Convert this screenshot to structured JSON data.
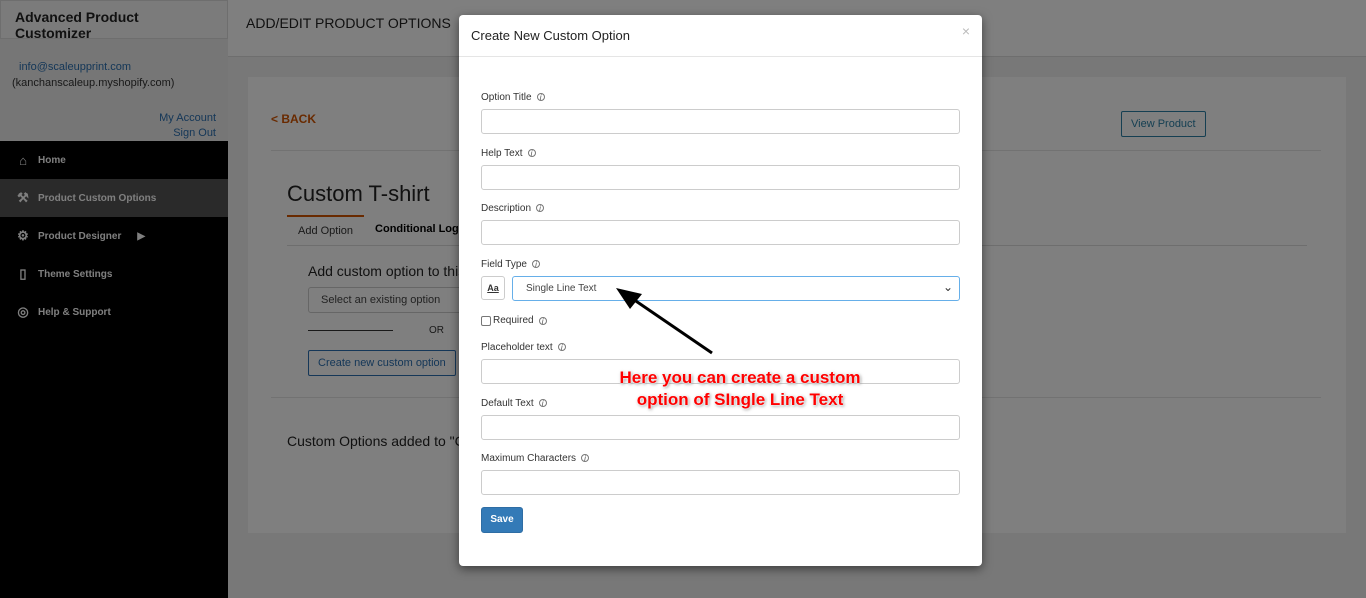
{
  "app": {
    "title": "Advanced Product Customizer",
    "email": "info@scaleupprint.com",
    "shop": "(kanchanscaleup.myshopify.com)",
    "my_account": "My Account",
    "sign_out": "Sign Out"
  },
  "sidebar": {
    "items": [
      {
        "label": "Home",
        "icon": "home-icon"
      },
      {
        "label": "Product Custom Options",
        "icon": "tools-icon"
      },
      {
        "label": "Product Designer",
        "icon": "network-icon"
      },
      {
        "label": "Theme Settings",
        "icon": "theme-icon"
      },
      {
        "label": "Help & Support",
        "icon": "lifebuoy-icon"
      }
    ]
  },
  "header": {
    "title": "ADD/EDIT PRODUCT OPTIONS"
  },
  "page": {
    "back": "< BACK",
    "view_product": "View Product",
    "product_title": "Custom T-shirt",
    "tabs": [
      "Add Option",
      "Conditional Logic"
    ],
    "add_heading": "Add custom option to this",
    "select_placeholder": "Select an existing option",
    "or": "OR",
    "create_new": "Create new custom option",
    "added_heading": "Custom Options added to \"Co"
  },
  "modal": {
    "title": "Create New Custom Option",
    "close": "×",
    "fields": {
      "option_title": "Option Title",
      "help_text": "Help Text",
      "description": "Description",
      "field_type": "Field Type",
      "field_type_value": "Single Line Text",
      "field_type_icon": "Aa",
      "required": "Required",
      "placeholder_text": "Placeholder text",
      "default_text": "Default Text",
      "max_chars": "Maximum Characters"
    },
    "save": "Save"
  },
  "annotation": {
    "text": "Here you can create a custom option of SIngle Line Text",
    "color": "#ff0000"
  }
}
